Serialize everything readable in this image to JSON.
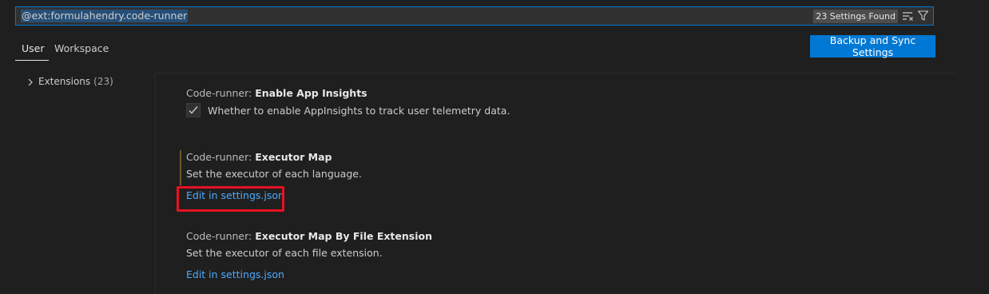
{
  "search": {
    "value": "@ext:formulahendry.code-runner",
    "count_badge": "23 Settings Found",
    "clear_icon": "clear-filter-icon",
    "filter_icon": "filter-icon"
  },
  "tabs": [
    {
      "label": "User",
      "active": true
    },
    {
      "label": "Workspace",
      "active": false
    }
  ],
  "sync_button": {
    "label": "Backup and Sync Settings"
  },
  "toc": {
    "items": [
      {
        "label": "Extensions",
        "count": "(23)",
        "icon": "chevron-right-icon"
      }
    ]
  },
  "settings": [
    {
      "category": "Code-runner: ",
      "name": "Enable App Insights",
      "checkbox_label": "Whether to enable AppInsights to track user telemetry data.",
      "checked": true
    },
    {
      "category": "Code-runner: ",
      "name": "Executor Map",
      "description": "Set the executor of each language.",
      "link": "Edit in settings.json"
    },
    {
      "category": "Code-runner: ",
      "name": "Executor Map By File Extension",
      "description": "Set the executor of each file extension.",
      "link": "Edit in settings.json"
    }
  ],
  "colors": {
    "accent": "#0078d4",
    "link": "#4daafc",
    "highlight": "#e81123",
    "background": "#1f1f1f"
  }
}
